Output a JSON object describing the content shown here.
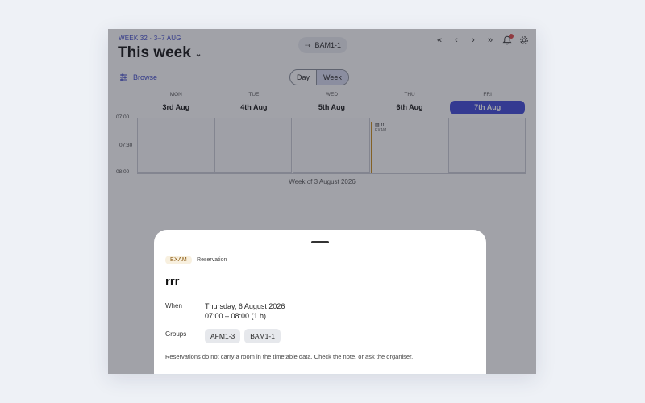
{
  "header": {
    "week_label": "WEEK 32 · 3–7 AUG",
    "title": "This week",
    "group_chip": "BAM1-1",
    "nav_icons": [
      "first-page-icon",
      "prev-icon",
      "next-icon",
      "last-page-icon",
      "bell-icon",
      "gear-icon"
    ]
  },
  "toolbar": {
    "browse_label": "Browse",
    "view_day": "Day",
    "view_week": "Week",
    "active_view": "Week"
  },
  "days": [
    {
      "name": "MON",
      "date": "3rd Aug"
    },
    {
      "name": "TUE",
      "date": "4th Aug"
    },
    {
      "name": "WED",
      "date": "5th Aug"
    },
    {
      "name": "THU",
      "date": "6th Aug"
    },
    {
      "name": "FRI",
      "date": "7th Aug",
      "today": true
    }
  ],
  "timeline": {
    "times": [
      "07:00",
      "07:30",
      "08:00"
    ],
    "event": {
      "title": "rrr",
      "kind": "EXAM",
      "day": "THU"
    },
    "week_of": "Week of 3 August 2026"
  },
  "sheet": {
    "tag": "EXAM",
    "kind": "Reservation",
    "title": "rrr",
    "when_label": "When",
    "when_date": "Thursday, 6 August 2026",
    "when_time": "07:00 – 08:00  (1 h)",
    "groups_label": "Groups",
    "groups": [
      "AFM1-3",
      "BAM1-1"
    ],
    "note": "Reservations do not carry a room in the timetable data. Check the note, or ask the organiser."
  },
  "colors": {
    "accent": "#3d46d6",
    "exam": "#c98b16",
    "overlay": "rgba(40,44,58,0.44)"
  }
}
